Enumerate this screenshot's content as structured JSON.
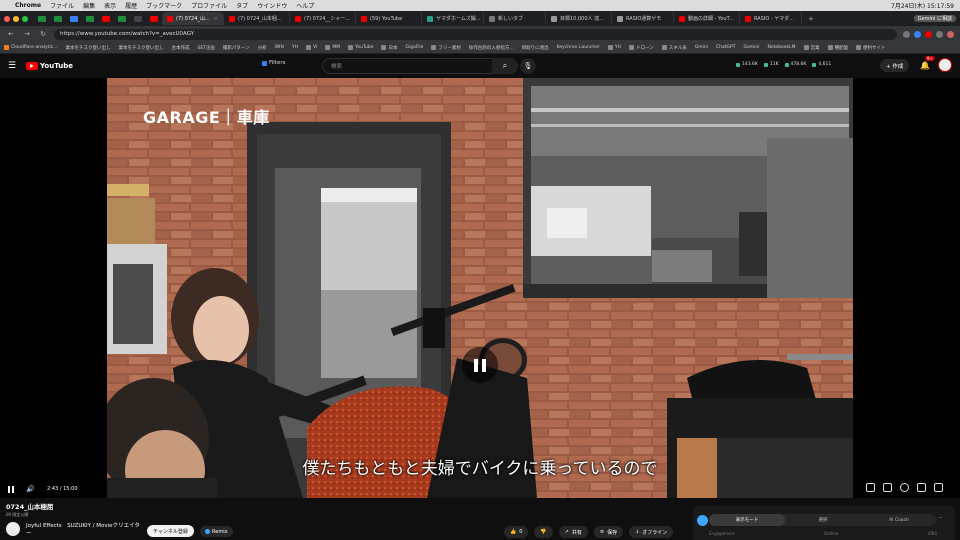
{
  "mac": {
    "apple": "",
    "app": "Chrome",
    "menus": [
      "ファイル",
      "編集",
      "表示",
      "履歴",
      "ブックマーク",
      "プロファイル",
      "タブ",
      "ウインドウ",
      "ヘルプ"
    ],
    "clock": "7月24日(木) 15:17:59",
    "gemini": "Gemini に相談"
  },
  "tabs": [
    {
      "label": "(7) 0724_山...",
      "active": true
    },
    {
      "label": "(7) 0724_山本梱...",
      "active": false
    },
    {
      "label": "(7) 0724__シャー...",
      "active": false
    },
    {
      "label": "(59) YouTube",
      "active": false
    },
    {
      "label": "ヤマダホームズ鍛...",
      "active": false
    },
    {
      "label": "新しいタブ",
      "active": false
    },
    {
      "label": "目標10,000人 達...",
      "active": false
    },
    {
      "label": "RASIO通算ゲモ",
      "active": false
    },
    {
      "label": "動画の詳細 - YouT...",
      "active": false
    },
    {
      "label": "RASIO - ヤマダ...",
      "active": false
    }
  ],
  "address": {
    "url": "https://www.youtube.com/watch?v=_avecU0AGY"
  },
  "bookmarks": [
    "Cloudflare analytic...",
    "業本をチスク登い出し",
    "業本をチスク登い出し",
    "台本作成",
    "SET企画",
    "撮影パターン",
    "分析",
    "WIN",
    "YH",
    "VI",
    "MM",
    "YouTube",
    "日本",
    "GigaFile",
    "フリー素材",
    "採作台詞の入替指方...",
    "目取りに適出",
    "Keychron Launcher",
    "YH",
    "ドローン",
    "スキル表",
    "Gmini",
    "ChatGPT",
    "Gemini",
    "NotebookLM",
    "営業",
    "種配盤",
    "便利サイト"
  ],
  "header": {
    "logo": "YouTube",
    "filters": "Filters",
    "search_placeholder": "検索",
    "stats": [
      "143.6K",
      "11K",
      "478.6K",
      "4,611"
    ],
    "create": "+ 作成",
    "notif_count": "9+"
  },
  "player": {
    "overlay_label": "GARAGE｜車庫",
    "subtitle": "僕たちもともと夫婦でバイクに乗っているので",
    "time": "2:43 / 15:00",
    "progress": 0.1811
  },
  "video": {
    "title": "0724_山本梱屈",
    "subtitle": "00 限定公開",
    "channel": "Joyful Effects　SUZUKIY / Movieクリエイター",
    "subscribe": "チャンネル登録",
    "remix": "Remix",
    "actions": [
      {
        "icon": "like-icon",
        "label": "0"
      },
      {
        "icon": "dislike-icon",
        "label": ""
      },
      {
        "icon": "share-icon",
        "label": "共有"
      },
      {
        "icon": "save-icon",
        "label": "保存"
      },
      {
        "icon": "download-icon",
        "label": "オフライン"
      }
    ]
  },
  "side_panel": {
    "tabs": [
      "表示モード",
      "選択",
      "AI Coach"
    ],
    "columns": [
      "Engagement",
      "Outline",
      "VIRS"
    ]
  },
  "colors": {
    "accent": "#ff0000",
    "bg": "#0f0f0f"
  }
}
